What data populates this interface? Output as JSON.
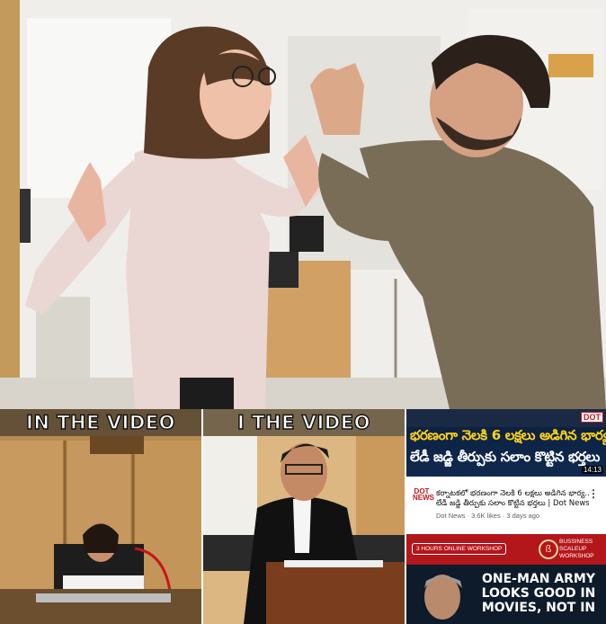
{
  "hero": {
    "scene": "Woman and man arguing in an office"
  },
  "clips": [
    {
      "caption": "IN THE VIDEO"
    },
    {
      "caption": "I THE VIDEO"
    }
  ],
  "feed": {
    "video1": {
      "thumb_logo": "DOT",
      "thumb_line1": "భరణంగా నెలకి 6 లక్షలు అడిగిన భార్య",
      "thumb_line2": "లేడీ జడ్జి తీర్పుకు సలాం కొట్టిన భర్తలు",
      "duration": "14:13",
      "channel_avatar_line1": "DOT",
      "channel_avatar_line2": "NEWS",
      "title_line1": "కర్నాటకలో భరణంగా నెలకి 6 లక్షలు అడిగిన భార్య..",
      "title_line2": "లేడీ జడ్జి తీర్పుకు సలాం కొట్టిన భర్తలు | Dot News",
      "stats": "Dot News · 3.6K likes · 3 days ago",
      "menu_glyph": "⋮"
    },
    "video2": {
      "workshop_label": "3 HOURS ONLINE WORKSHOP",
      "brand_glyph": "ß",
      "brand_line1": "BUSSINESS",
      "brand_line2": "SCALEUP",
      "brand_line3": "WORKSHOP",
      "headline_line1": "ONE-MAN ARMY",
      "headline_line2": "LOOKS GOOD IN",
      "headline_line3": "MOVIES, NOT IN"
    }
  },
  "colors": {
    "thumb1_bg": "#0c1f3d",
    "thumb1_yellow": "#ffd21a",
    "thumb2_red": "#b3161b"
  }
}
